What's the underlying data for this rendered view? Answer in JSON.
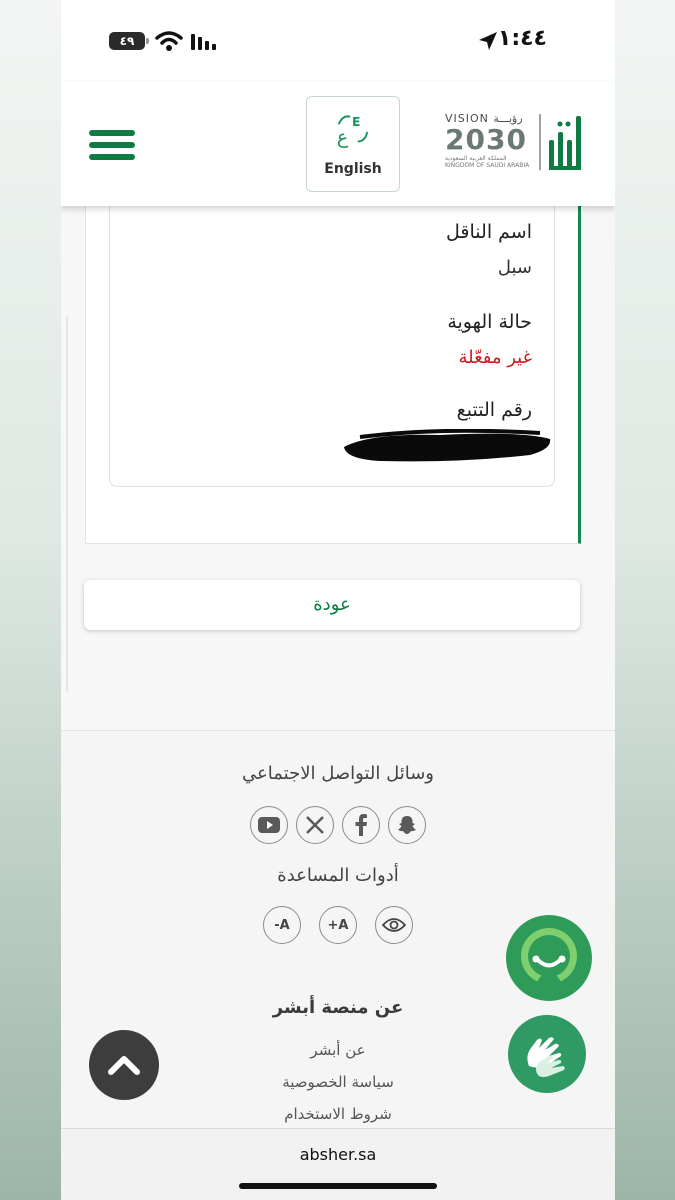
{
  "status_bar": {
    "time": "١:٤٤",
    "battery": "٤٩"
  },
  "header": {
    "language_button": "English"
  },
  "vision_logo": {
    "line1": "VISION رؤيـــة",
    "line2": "2030",
    "line3": "المملكة العربية السعودية KINGDOM OF SAUDI ARABIA"
  },
  "details": {
    "carrier_label": "اسم الناقل",
    "carrier_value": "سبل",
    "identity_status_label": "حالة الهوية",
    "identity_status_value": "غير مفعّلة",
    "tracking_label": "رقم التتبع"
  },
  "back_button": "عودة",
  "footer": {
    "social_title": "وسائل التواصل الاجتماعي",
    "accessibility_title": "أدوات المساعدة",
    "font_increase": "+A",
    "font_decrease": "-A",
    "about_title": "عن منصة أبشر",
    "links": [
      "عن أبشر",
      "سياسة الخصوصية",
      "شروط الاستخدام"
    ]
  },
  "url_bar": {
    "url": "absher.sa"
  },
  "colors": {
    "brand_green": "#0e7a44",
    "error_red": "#d0181f"
  }
}
